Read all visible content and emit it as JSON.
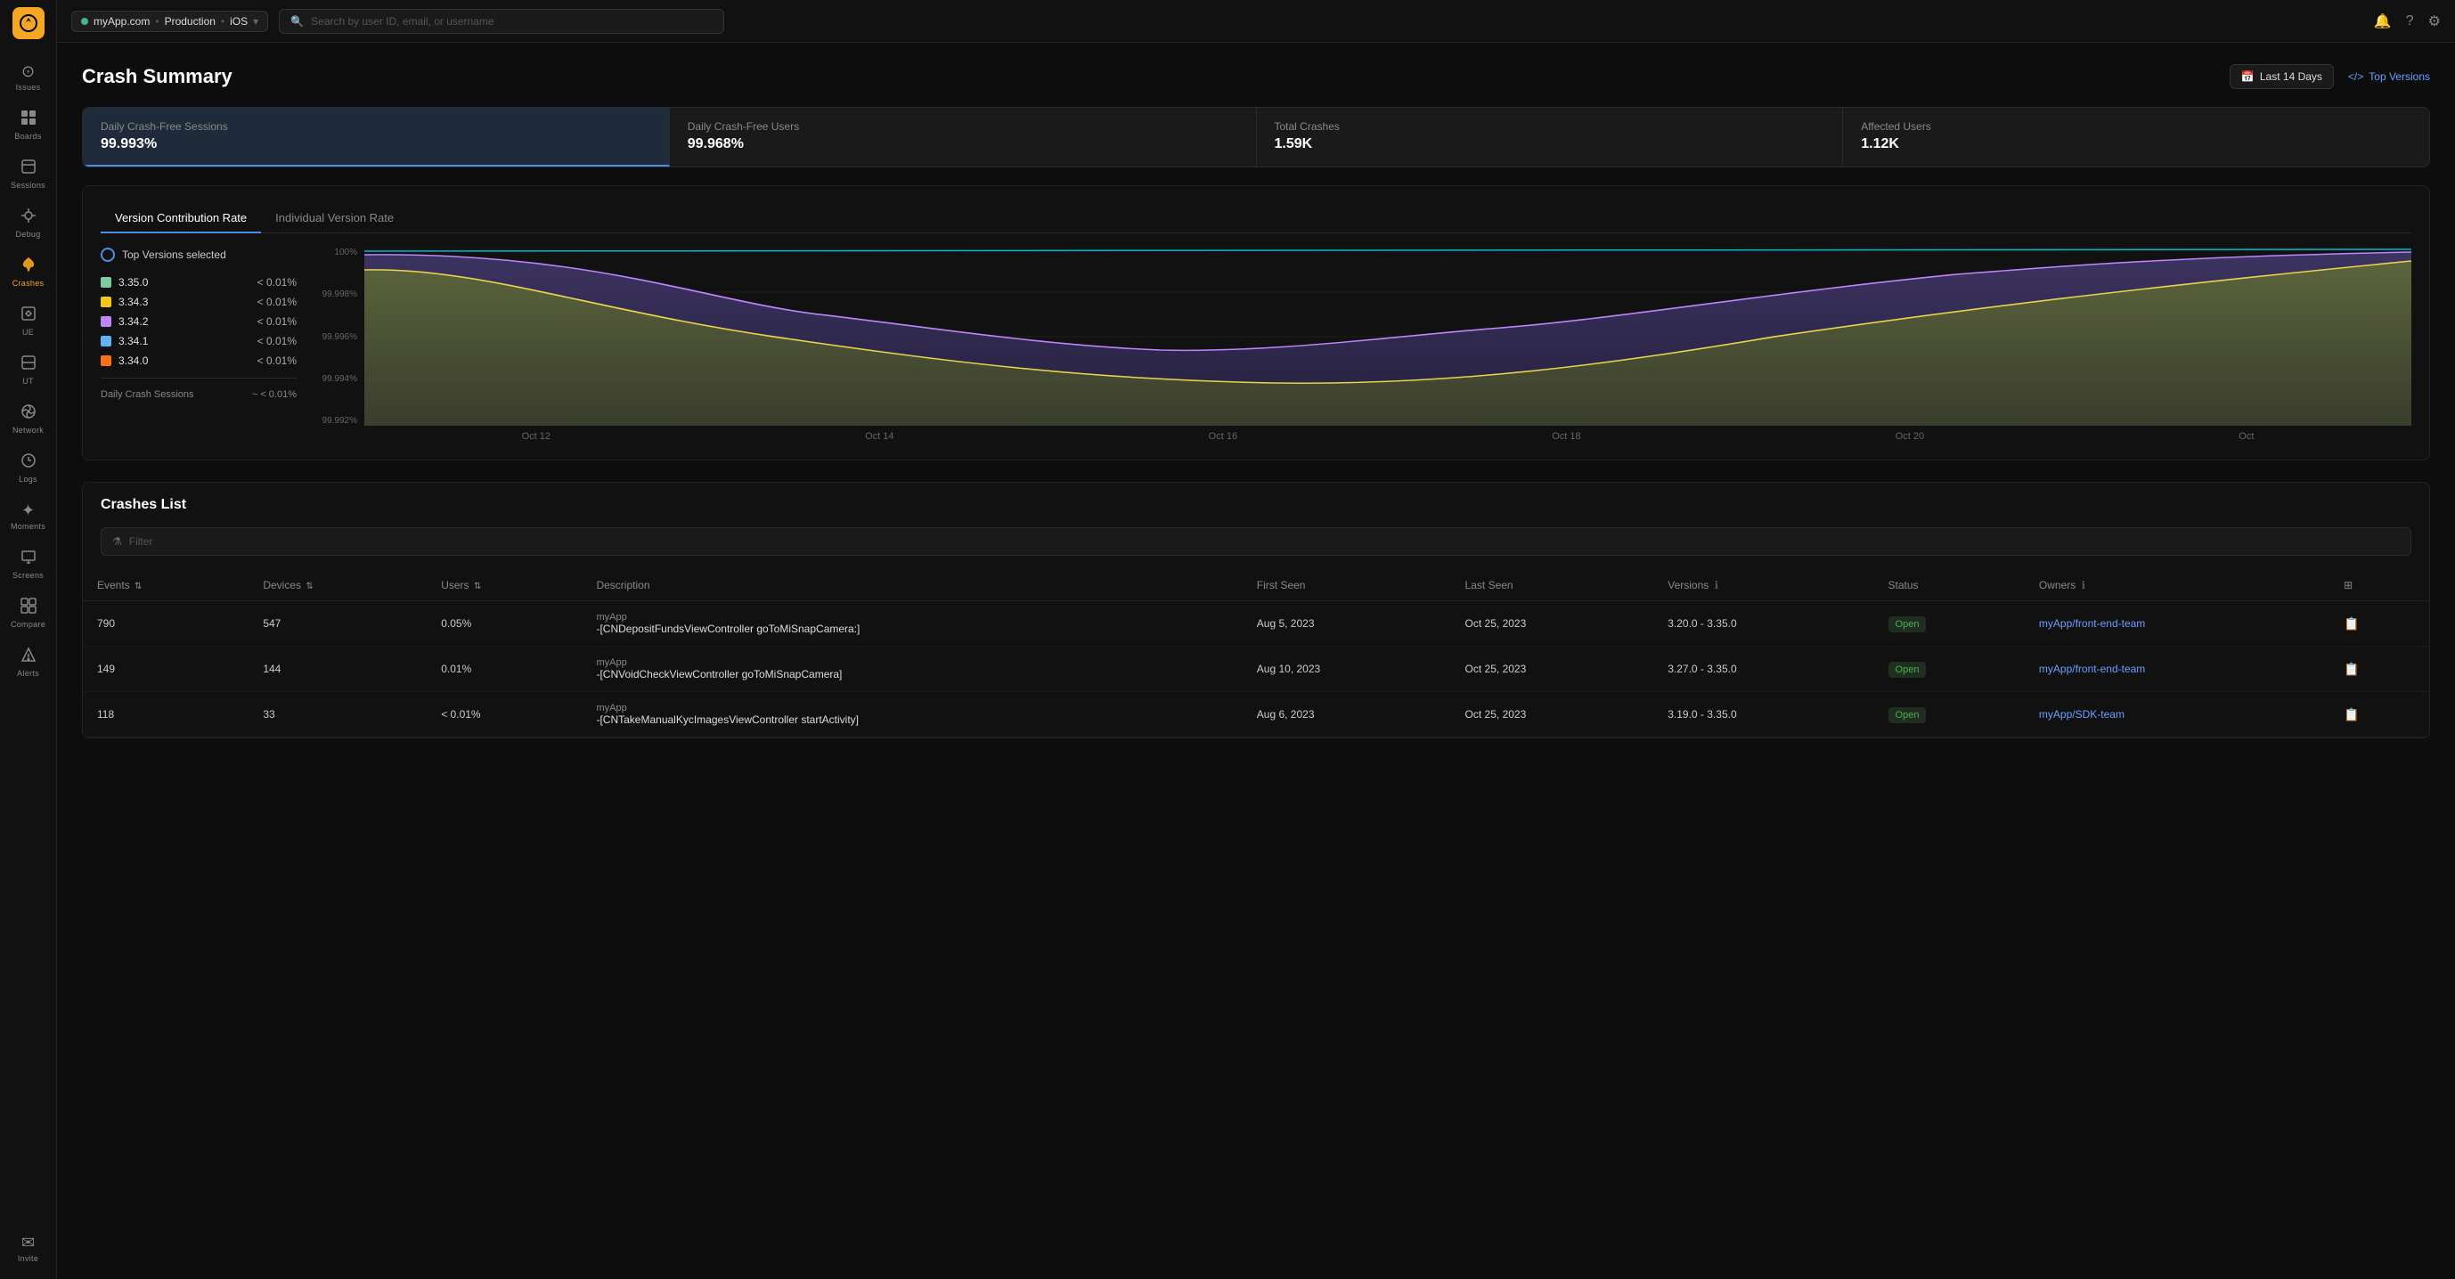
{
  "sidebar": {
    "logo": "⊕",
    "items": [
      {
        "id": "issues",
        "label": "Issues",
        "icon": "⊙",
        "active": false
      },
      {
        "id": "boards",
        "label": "Boards",
        "icon": "▦",
        "active": false
      },
      {
        "id": "sessions",
        "label": "Sessions",
        "icon": "◫",
        "active": false
      },
      {
        "id": "debug",
        "label": "Debug",
        "icon": "⚙",
        "active": false
      },
      {
        "id": "crashes",
        "label": "Crashes",
        "icon": "🔥",
        "active": true
      },
      {
        "id": "ue",
        "label": "UE",
        "icon": "◈",
        "active": false
      },
      {
        "id": "ut",
        "label": "UT",
        "icon": "◫",
        "active": false
      },
      {
        "id": "network",
        "label": "Network",
        "icon": "◉",
        "active": false
      },
      {
        "id": "logs",
        "label": "Logs",
        "icon": "◷",
        "active": false
      },
      {
        "id": "moments",
        "label": "Moments",
        "icon": "✦",
        "active": false
      },
      {
        "id": "screens",
        "label": "Screens",
        "icon": "◱",
        "active": false
      },
      {
        "id": "compare",
        "label": "Compare",
        "icon": "⊞",
        "active": false
      },
      {
        "id": "alerts",
        "label": "Alerts",
        "icon": "◷",
        "active": false
      },
      {
        "id": "invite",
        "label": "Invite",
        "icon": "✉",
        "active": false
      }
    ]
  },
  "topbar": {
    "app_name": "myApp.com",
    "environment": "Production",
    "platform": "iOS",
    "search_placeholder": "Search by user ID, email, or username"
  },
  "page": {
    "title": "Crash Summary",
    "date_range": "Last 14 Days",
    "versions_label": "Top Versions"
  },
  "stats": [
    {
      "label": "Daily Crash-Free Sessions",
      "value": "99.993%",
      "active": true
    },
    {
      "label": "Daily Crash-Free Users",
      "value": "99.968%",
      "active": false
    },
    {
      "label": "Total Crashes",
      "value": "1.59K",
      "active": false
    },
    {
      "label": "Affected Users",
      "value": "1.12K",
      "active": false
    }
  ],
  "chart": {
    "tabs": [
      {
        "label": "Version Contribution Rate",
        "active": true
      },
      {
        "label": "Individual Version Rate",
        "active": false
      }
    ],
    "legend_header": "Top Versions selected",
    "legend_items": [
      {
        "version": "3.35.0",
        "value": "< 0.01%",
        "color": "#7ecba1"
      },
      {
        "version": "3.34.3",
        "value": "< 0.01%",
        "color": "#f5c518"
      },
      {
        "version": "3.34.2",
        "value": "< 0.01%",
        "color": "#c084fc"
      },
      {
        "version": "3.34.1",
        "value": "< 0.01%",
        "color": "#60b4f5"
      },
      {
        "version": "3.34.0",
        "value": "< 0.01%",
        "color": "#f97316"
      }
    ],
    "session_label": "Daily Crash Sessions",
    "session_value": "~ < 0.01%",
    "y_labels": [
      "100%",
      "99.998%",
      "99.996%",
      "99.994%",
      "99.992%"
    ],
    "x_labels": [
      "Oct 12",
      "Oct 14",
      "Oct 16",
      "Oct 18",
      "Oct 20",
      "Oct"
    ]
  },
  "crashes_list": {
    "title": "Crashes List",
    "filter_placeholder": "Filter",
    "columns": [
      {
        "label": "Events",
        "sortable": true
      },
      {
        "label": "Devices",
        "sortable": true
      },
      {
        "label": "Users",
        "sortable": true
      },
      {
        "label": "Description",
        "sortable": false
      },
      {
        "label": "First Seen",
        "sortable": false
      },
      {
        "label": "Last Seen",
        "sortable": false
      },
      {
        "label": "Versions",
        "sortable": false,
        "info": true
      },
      {
        "label": "Status",
        "sortable": false
      },
      {
        "label": "Owners",
        "sortable": false,
        "info": true
      }
    ],
    "rows": [
      {
        "events": "790",
        "devices": "547",
        "users": "0.05%",
        "app": "myApp",
        "description": "-[CNDepositFundsViewController goToMiSnapCamera:]",
        "first_seen": "Aug 5, 2023",
        "last_seen": "Oct 25, 2023",
        "versions": "3.20.0 - 3.35.0",
        "status": "Open",
        "owner": "myApp/front-end-team"
      },
      {
        "events": "149",
        "devices": "144",
        "users": "0.01%",
        "app": "myApp",
        "description": "-[CNVoidCheckViewController goToMiSnapCamera]",
        "first_seen": "Aug 10, 2023",
        "last_seen": "Oct 25, 2023",
        "versions": "3.27.0 - 3.35.0",
        "status": "Open",
        "owner": "myApp/front-end-team"
      },
      {
        "events": "118",
        "devices": "33",
        "users": "< 0.01%",
        "app": "myApp",
        "description": "-[CNTakeManualKycImagesViewController startActivity]",
        "first_seen": "Aug 6, 2023",
        "last_seen": "Oct 25, 2023",
        "versions": "3.19.0 - 3.35.0",
        "status": "Open",
        "owner": "myApp/SDK-team"
      }
    ]
  }
}
